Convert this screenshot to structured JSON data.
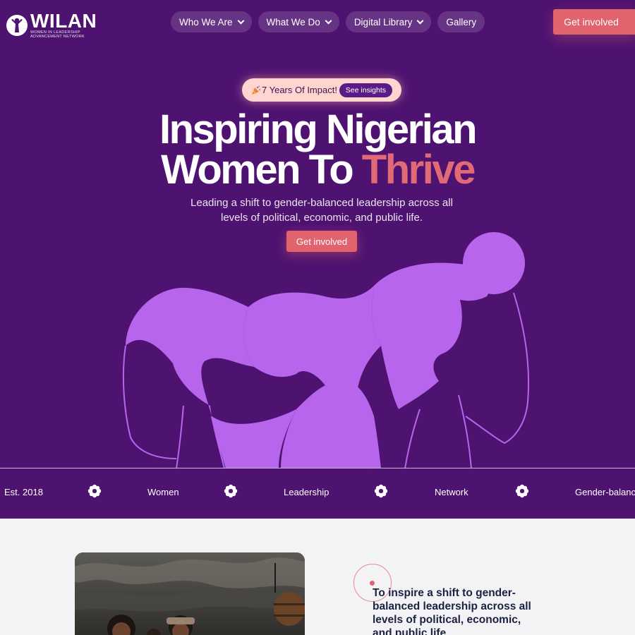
{
  "brand": {
    "name": "WILAN",
    "tagline": "WOMEN IN LEADERSHIP ADVANCEMENT NETWORK",
    "logo_icon": "woman-raising-arms-icon"
  },
  "nav": {
    "items": [
      {
        "label": "Who We Are",
        "has_dropdown": true
      },
      {
        "label": "What We Do",
        "has_dropdown": true
      },
      {
        "label": "Digital Library",
        "has_dropdown": true
      },
      {
        "label": "Gallery",
        "has_dropdown": false
      }
    ],
    "cta": "Get involved"
  },
  "badge": {
    "icon": "party-popper-icon",
    "text": "7 Years Of Impact!",
    "button": "See insights"
  },
  "hero": {
    "line1": "Inspiring Nigerian",
    "line2_prefix": "Women To ",
    "line2_accent": "Thrive",
    "subtitle": "Leading a shift to gender-balanced leadership across all levels of political, economic, and public life.",
    "cta": "Get involved"
  },
  "ticker": {
    "items": [
      "Est. 2018",
      "Women",
      "Leadership",
      "Network",
      "Gender-balanc"
    ],
    "separator_icon": "flower-icon"
  },
  "mission": {
    "text": "To inspire a shift to gender-balanced leadership across all levels of political, economic, and public life"
  },
  "colors": {
    "hero_bg": "#4e1270",
    "accent": "#e0636e",
    "illustration": "#b865ee",
    "badge_bg": "#ffd5cf",
    "page_bg": "#f3f3f6",
    "mission_text": "#1b2240"
  }
}
